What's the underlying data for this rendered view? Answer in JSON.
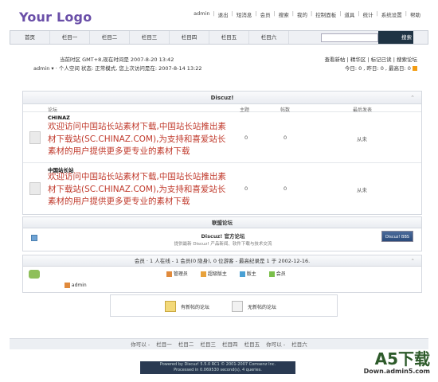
{
  "logo": "Your Logo",
  "topnav": [
    "admin",
    "退出",
    "短消息",
    "会员",
    "搜索",
    "我的",
    "控制面板",
    "道具",
    "统计",
    "系统设置",
    "帮助"
  ],
  "navbar": [
    "首页",
    "栏目一",
    "栏目二",
    "栏目三",
    "栏目四",
    "栏目五",
    "栏目六"
  ],
  "search_btn": "搜索",
  "info": {
    "time_line": "当前时区 GMT+8,现在时间是 2007-8-20 13:42",
    "user_line": "admin ▾ · 个人空间 状态: 正常模式, 您上次访问是在: 2007-8-14 13:22",
    "right_links": "查看新帖 | 精华区 | 标记已读 | 搜索论坛",
    "stats": "今日: 0 , 昨日: 0 , 最高日: 0"
  },
  "forum_table": {
    "title": "Discuz!",
    "col_forum": "论坛",
    "col_topics": "主题",
    "col_posts": "帖数",
    "col_last": "最后发表",
    "rows": [
      {
        "name": "CHINAZ",
        "desc": "欢迎访问中国站长站素材下载,中国站长站推出素材下载站(SC.CHINAZ.COM),为支持和喜爱站长素材的用户提供更多更专业的素材下载",
        "topics": "0",
        "posts": "0",
        "last": "从未"
      },
      {
        "name": "中国站长站",
        "desc": "欢迎访问中国站长站素材下载,中国站长站推出素材下载站(SC.CHINAZ.COM),为支持和喜爱站长素材的用户提供更多更专业的素材下载",
        "topics": "0",
        "posts": "0",
        "last": "从未"
      }
    ]
  },
  "links": {
    "title": "联盟论坛",
    "name": "Discuz! 官方论坛",
    "desc": "提供最新 Discuz! 产品新闻、软件下载与技术交流",
    "badge": "Discuz! BBS"
  },
  "online": {
    "title": "会员 · 1 人在线 - 1 会员(0 隐身), 0 位游客 - 最高纪录是 1 于 2002-12-16.",
    "legend": [
      "管理员",
      "超级版主",
      "版主",
      "会员"
    ],
    "users": [
      "admin"
    ]
  },
  "legend": {
    "new": "有新帖的论坛",
    "nonew": "无新帖的论坛"
  },
  "footer_nav": [
    "你可以 -",
    "栏目一",
    "栏目二",
    "栏目三",
    "栏目四",
    "栏目五",
    "你可以 -",
    "栏目六"
  ],
  "powered": {
    "line1": "Powered by Discuz! 5.5.0 RC1 © 2001-2007 Comsenz Inc.",
    "line2": "Processed in 0.069530 second(s), 4 queries."
  },
  "watermark": {
    "big": "A5下载",
    "small": "Down.admin5.com"
  }
}
